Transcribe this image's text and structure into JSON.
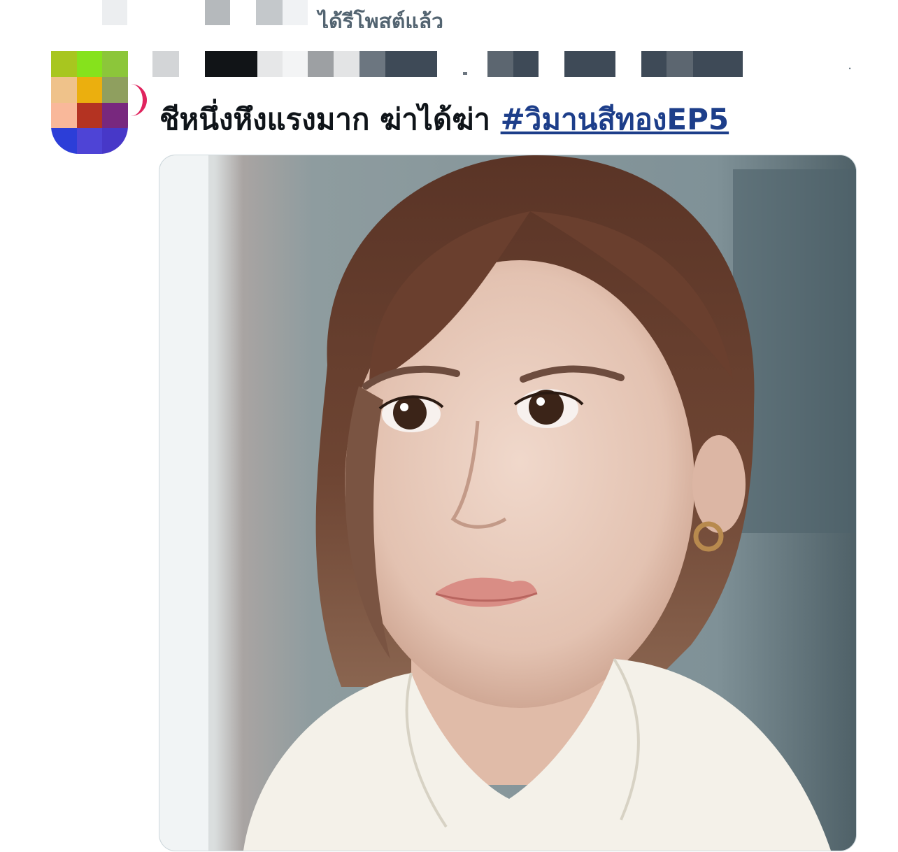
{
  "repost": {
    "label": "ได้รีโพสต์แล้ว"
  },
  "tweet": {
    "text": "ชีหนึ่งหึงแรงมาก ฆ่าได้ฆ่า",
    "hashtag": "#วิมานสีทองEP5"
  },
  "media": {
    "alt_name": "tweet-photo"
  },
  "colors": {
    "hashtag": "#1d3e8a",
    "text": "#0f1419",
    "secondary": "#536471"
  },
  "icons": {
    "more": "more-icon"
  }
}
